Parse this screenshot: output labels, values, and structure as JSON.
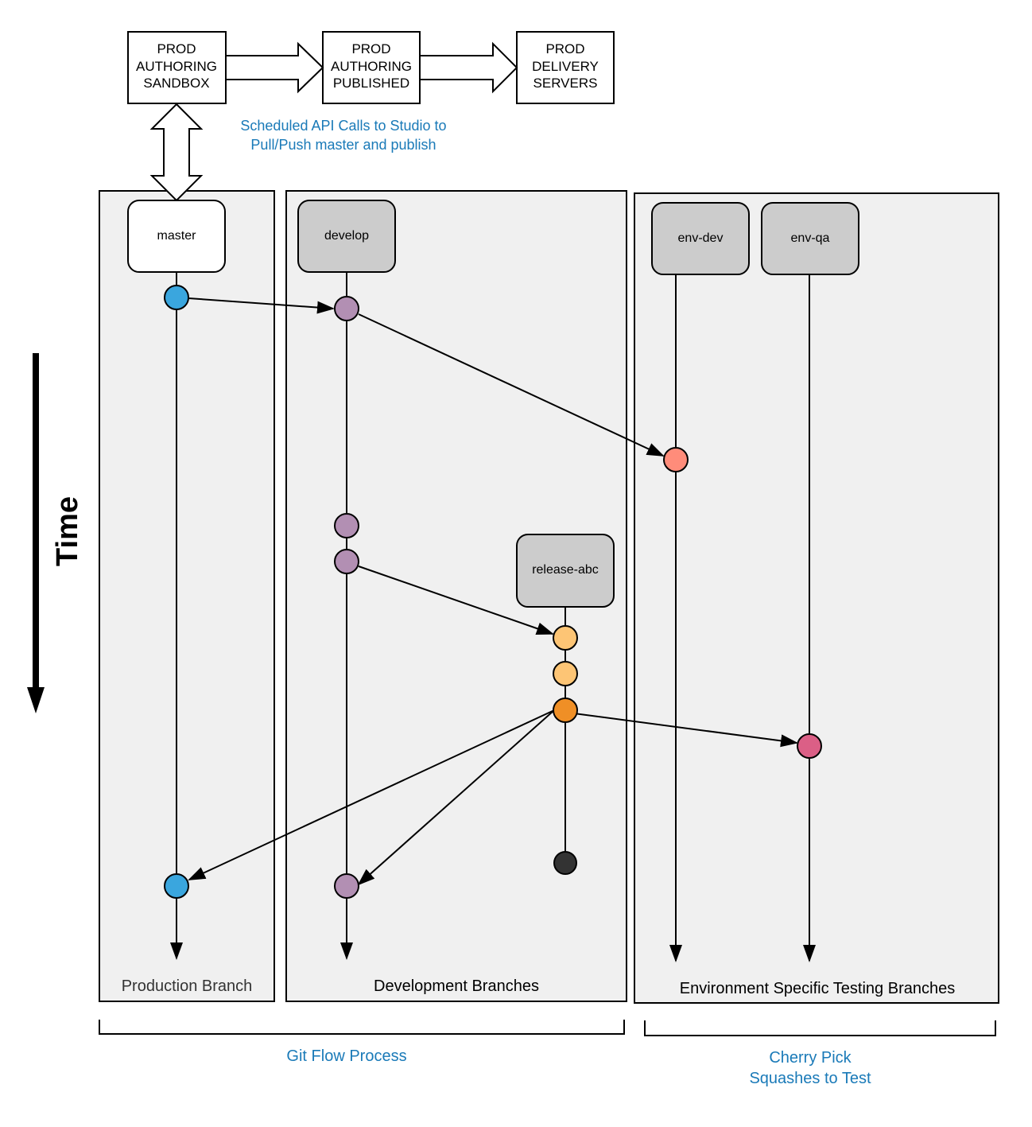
{
  "colors": {
    "blue_text": "#1a7ab8",
    "panel_fill": "#f0f0f0",
    "branch_fill": "#cccccc",
    "master_fill": "#ffffff",
    "commit_master": "#3aa6de",
    "commit_develop": "#b28fb3",
    "commit_env_dev": "#ff8c7a",
    "commit_release": "#fdc575",
    "commit_release_final": "#ef8f26",
    "commit_env_qa": "#db5f86",
    "commit_end": "#333333"
  },
  "pipeline": {
    "boxes": [
      {
        "id": "sandbox",
        "lines": [
          "PROD",
          "AUTHORING",
          "SANDBOX"
        ]
      },
      {
        "id": "published",
        "lines": [
          "PROD",
          "AUTHORING",
          "PUBLISHED"
        ]
      },
      {
        "id": "delivery",
        "lines": [
          "PROD",
          "DELIVERY",
          "SERVERS"
        ]
      }
    ],
    "sync_note": [
      "Scheduled API Calls to Studio to",
      "Pull/Push master  and publish"
    ]
  },
  "time_label": "Time",
  "panels": {
    "production": {
      "label": "Production Branch"
    },
    "development": {
      "label": "Development Branches"
    },
    "environment": {
      "label": "Environment Specific Testing Branches"
    }
  },
  "branches": {
    "master": "master",
    "develop": "develop",
    "release": "release-abc",
    "env_dev": "env-dev",
    "env_qa": "env-qa"
  },
  "groups": {
    "git_flow": "Git Flow Process",
    "cherry_pick": [
      "Cherry Pick",
      "Squashes to Test"
    ]
  }
}
